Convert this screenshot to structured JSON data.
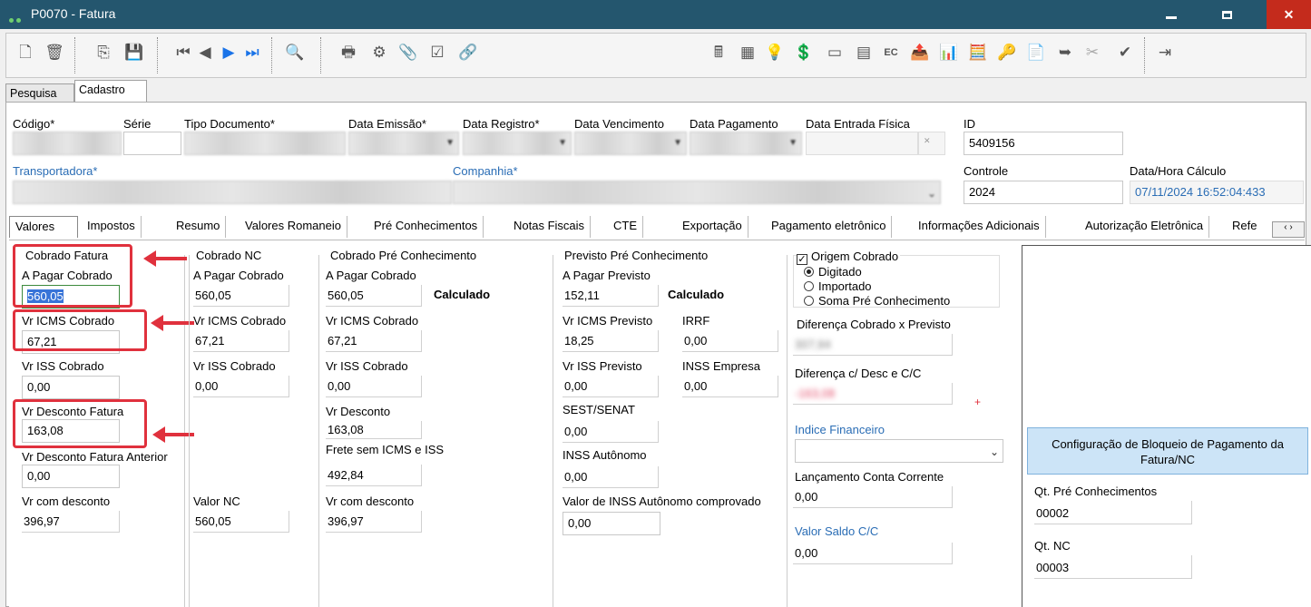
{
  "window": {
    "title": "P0070 - Fatura"
  },
  "top_tabs": [
    "Pesquisa",
    "Cadastro"
  ],
  "header": {
    "codigo_label": "Código*",
    "serie_label": "Série",
    "tipo_label": "Tipo Documento*",
    "data_emissao_label": "Data Emissão*",
    "data_registro_label": "Data Registro*",
    "data_vencimento_label": "Data Vencimento",
    "data_pagamento_label": "Data Pagamento",
    "data_entrada_label": "Data Entrada Física",
    "id_label": "ID",
    "id_value": "5409156",
    "transportadora_label": "Transportadora*",
    "companhia_label": "Companhia*",
    "controle_label": "Controle",
    "controle_value": "2024",
    "data_calculo_label": "Data/Hora Cálculo",
    "data_calculo_value": "07/11/2024 16:52:04:433"
  },
  "main_tabs": [
    "Valores",
    "Impostos",
    "Resumo",
    "Valores Romaneio",
    "Pré Conhecimentos",
    "Notas Fiscais",
    "CTE",
    "Exportação",
    "Pagamento eletrônico",
    "Informações Adicionais",
    "Autorização Eletrônica",
    "Refe"
  ],
  "cobrado_fatura": {
    "title": "Cobrado Fatura",
    "a_pagar_label": "A Pagar Cobrado",
    "a_pagar_value": "560,05",
    "icms_label": "Vr ICMS Cobrado",
    "icms_value": "67,21",
    "iss_label": "Vr ISS Cobrado",
    "iss_value": "0,00",
    "desconto_label": "Vr Desconto Fatura",
    "desconto_value": "163,08",
    "desc_anterior_label": "Vr Desconto Fatura Anterior",
    "desc_anterior_value": "0,00",
    "com_desconto_label": "Vr com desconto",
    "com_desconto_value": "396,97"
  },
  "cobrado_nc": {
    "title": "Cobrado NC",
    "a_pagar_label": "A Pagar Cobrado",
    "a_pagar_value": "560,05",
    "icms_label": "Vr ICMS Cobrado",
    "icms_value": "67,21",
    "iss_label": "Vr ISS Cobrado",
    "iss_value": "0,00",
    "valor_nc_label": "Valor NC",
    "valor_nc_value": "560,05"
  },
  "cobrado_pre": {
    "title": "Cobrado Pré Conhecimento",
    "a_pagar_label": "A Pagar Cobrado",
    "a_pagar_value": "560,05",
    "calculado": "Calculado",
    "icms_label": "Vr ICMS Cobrado",
    "icms_value": "67,21",
    "iss_label": "Vr ISS Cobrado",
    "iss_value": "0,00",
    "desconto_label": "Vr Desconto",
    "desconto_value": "163,08",
    "frete_label": "Frete sem ICMS e ISS",
    "frete_value": "492,84",
    "com_desconto_label": "Vr com desconto",
    "com_desconto_value": "396,97"
  },
  "previsto_pre": {
    "title": "Previsto Pré Conhecimento",
    "a_pagar_label": "A Pagar Previsto",
    "a_pagar_value": "152,11",
    "calculado": "Calculado",
    "icms_label": "Vr ICMS Previsto",
    "icms_value": "18,25",
    "irrf_label": "IRRF",
    "irrf_value": "0,00",
    "iss_label": "Vr ISS Previsto",
    "iss_value": "0,00",
    "inss_emp_label": "INSS Empresa",
    "inss_emp_value": "0,00",
    "sest_label": "SEST/SENAT",
    "sest_value": "0,00",
    "inss_aut_label": "INSS Autônomo",
    "inss_aut_value": "0,00",
    "inss_comp_label": "Valor de INSS Autônomo comprovado",
    "inss_comp_value": "0,00"
  },
  "origem": {
    "title": "Origem Cobrado",
    "opt1": "Digitado",
    "opt2": "Importado",
    "opt3": "Soma Pré Conhecimento"
  },
  "right": {
    "dif_prev_label": "Diferença Cobrado x Previsto",
    "dif_desc_label": "Diferença  c/ Desc e C/C",
    "plus": "+",
    "indice_label": "Indice Financeiro",
    "lcc_label": "Lançamento Conta Corrente",
    "lcc_value": "0,00",
    "saldo_label": "Valor Saldo C/C",
    "saldo_value": "0,00",
    "cfg_button": "Configuração de Bloqueio de Pagamento da Fatura/NC",
    "qt_pre_label": "Qt. Pré Conhecimentos",
    "qt_pre_value": "00002",
    "qt_nc_label": "Qt. NC",
    "qt_nc_value": "00003"
  },
  "colors": {
    "titlebar": "#24566e",
    "highlight": "#e0313d",
    "link_label": "#2a6db5"
  }
}
